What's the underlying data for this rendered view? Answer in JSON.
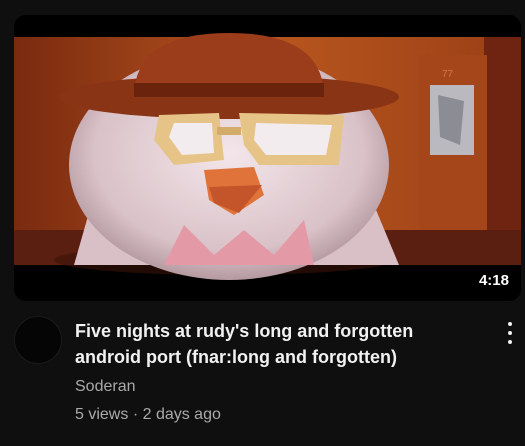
{
  "video": {
    "duration": "4:18",
    "title_line1": "Five nights at rudy's long and forgotten",
    "title_line2": "android port (fnar:long and forgotten)",
    "channel": "Soderan",
    "views": "5 views",
    "separator": "·",
    "age": "2 days ago",
    "thumbnail_text": "77"
  }
}
